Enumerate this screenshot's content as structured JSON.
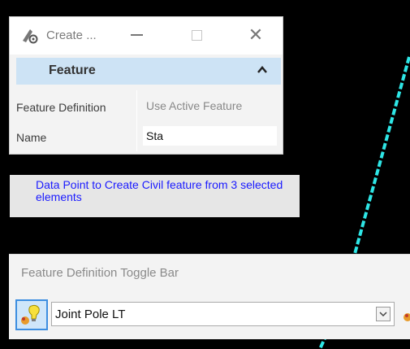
{
  "dialog": {
    "title": "Create ...",
    "section_title": "Feature",
    "rows": [
      {
        "label": "Feature Definition",
        "value": "Use Active Feature"
      },
      {
        "label": "Name",
        "value": "Sta"
      }
    ]
  },
  "prompt": {
    "text": "Data Point to Create Civil feature from 3 selected elements"
  },
  "toggle_bar": {
    "title": "Feature Definition Toggle Bar",
    "selected": "Joint Pole LT"
  },
  "colors": {
    "canvas": "#000000",
    "line": "#2ee6e6",
    "prompt_text": "#1a1aff",
    "header": "#cde3f5"
  }
}
